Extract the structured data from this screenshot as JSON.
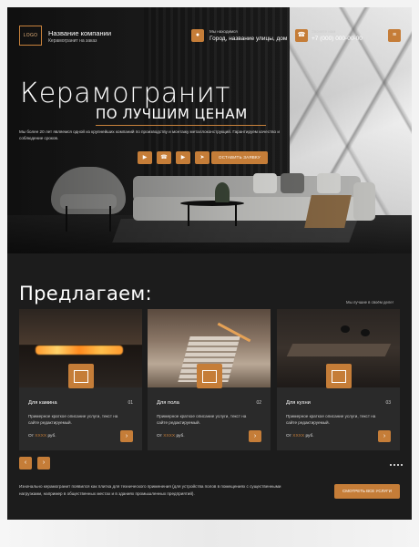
{
  "header": {
    "logo": "LOGO",
    "company_name": "Название компании",
    "company_sub": "Керамогранит на заказ",
    "address_label": "Мы находимся",
    "address_value": "Город, название улицы, дом",
    "phone_label": "Звоните нам",
    "phone_value": "+7 (000) 000-00-00",
    "icon_location": "location-pin-icon",
    "icon_phone": "phone-icon",
    "icon_menu": "menu-icon"
  },
  "hero": {
    "title": "Керамогранит",
    "subtitle": "ПО ЛУЧШИМ ЦЕНАМ",
    "description": "Мы более 20 лет являемся одной из крупнейших компаний по производству и монтажу металлоконструкций. Гарантируем качество и соблюдение сроков.",
    "social": [
      "whatsapp-icon",
      "viber-icon",
      "youtube-icon",
      "telegram-icon"
    ],
    "cta": "ОСТАВИТЬ ЗАЯВКУ"
  },
  "offers": {
    "title": "Предлагаем:",
    "note": "Мы лучшие в своём деле!",
    "cards": [
      {
        "title": "Для камина",
        "num": "01",
        "text": "Примерное краткое описание услуги, текст на сайте редактируемый.",
        "price_prefix": "От",
        "price": "XXXX",
        "price_unit": "руб.",
        "icon": "fireplace-icon"
      },
      {
        "title": "Для пола",
        "num": "02",
        "text": "Примерное краткое описание услуги, текст на сайте редактируемый.",
        "price_prefix": "От",
        "price": "XXXX",
        "price_unit": "руб.",
        "icon": "stairs-icon"
      },
      {
        "title": "Для кухни",
        "num": "03",
        "text": "Примерное краткое описание услуги, текст на сайте редактируемый.",
        "price_prefix": "От",
        "price": "XXXX",
        "price_unit": "руб.",
        "icon": "kitchen-icon"
      }
    ],
    "bottom_text": "Изначально керамогранит появился как плитка для технического применения (для устройства полов в помещениях с существенными нагрузками, например в общественных местах и в зданиях промышленных предприятий).",
    "cta_all": "СМОТРЕТЬ ВСЕ УСЛУГИ"
  },
  "colors": {
    "accent": "#c57d38",
    "background": "#1c1c1c",
    "card": "#2a2a2a"
  }
}
